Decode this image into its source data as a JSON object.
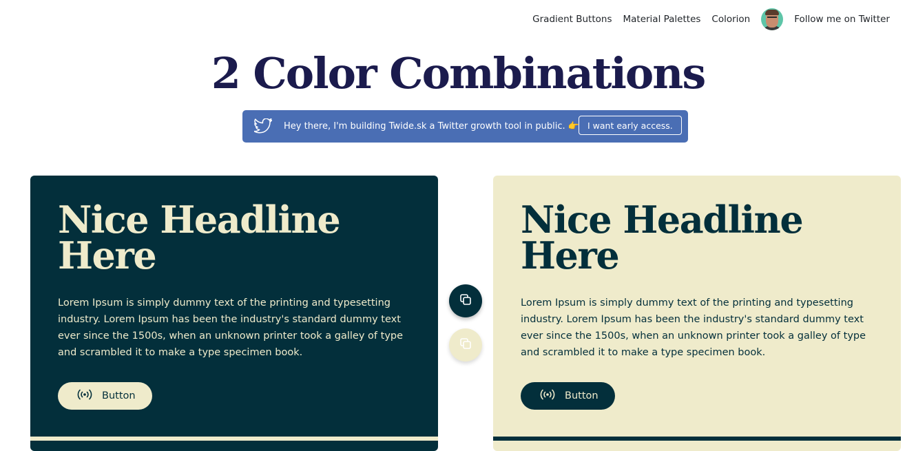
{
  "nav": {
    "links": [
      "Gradient Buttons",
      "Material Palettes",
      "Colorion"
    ],
    "avatar_icon": "user-avatar",
    "twitter_link": "Follow me on Twitter"
  },
  "page": {
    "title": "2 Color Combinations"
  },
  "banner": {
    "icon": "twitter-bird-icon",
    "message": "Hey there, I'm building Twide.sk a Twitter growth tool in public. 👉",
    "cta": "I want early access.",
    "color": "#4a6eb4"
  },
  "palette": {
    "dark": "#032f3b",
    "light": "#efebcb"
  },
  "cards": [
    {
      "headline": "Nice Headline Here",
      "body": "Lorem Ipsum is simply dummy text of the printing and typesetting industry. Lorem Ipsum has been the industry's standard dummy text ever since the 1500s, when an unknown printer took a galley of type and scrambled it to make a type specimen book.",
      "button": "Button",
      "button_icon": "broadcast-icon"
    },
    {
      "headline": "Nice Headline Here",
      "body": "Lorem Ipsum is simply dummy text of the printing and typesetting industry. Lorem Ipsum has been the industry's standard dummy text ever since the 1500s, when an unknown printer took a galley of type and scrambled it to make a type specimen book.",
      "button": "Button",
      "button_icon": "broadcast-icon"
    }
  ],
  "copy_buttons": [
    "copy-dark-color-icon",
    "copy-light-color-icon"
  ]
}
